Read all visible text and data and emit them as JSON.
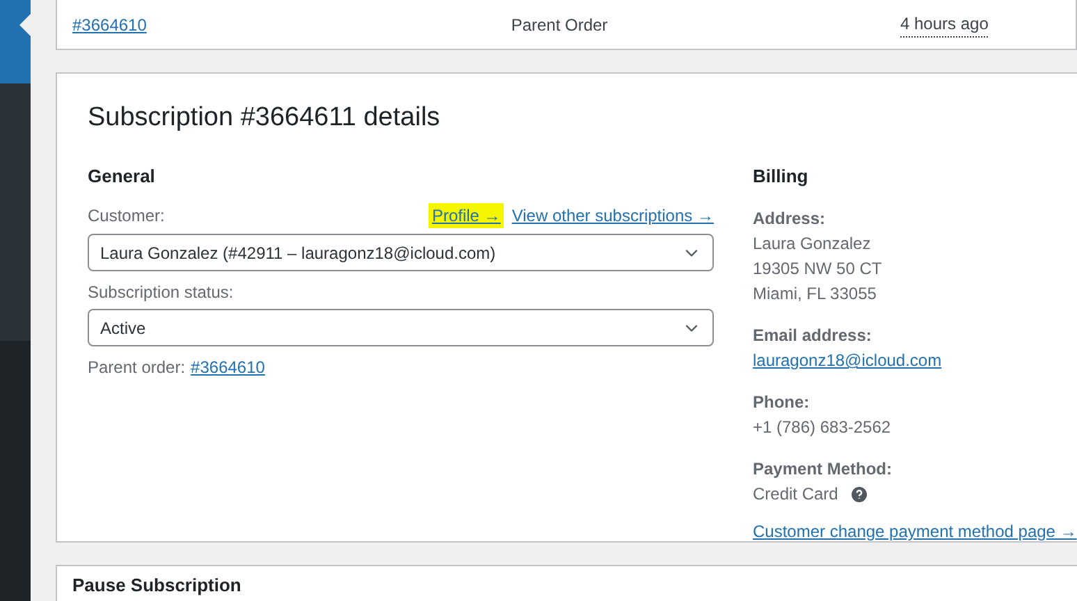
{
  "related_order": {
    "number": "#3664610",
    "relationship": "Parent Order",
    "date": "4 hours ago"
  },
  "details": {
    "title": "Subscription #3664611 details",
    "general": {
      "heading": "General",
      "customer_label": "Customer:",
      "profile_link": "Profile →",
      "profile_highlighted": true,
      "other_link": "View other subscriptions →",
      "customer_value": "Laura Gonzalez (#42911 – lauragonz18@icloud.com)",
      "status_label": "Subscription status:",
      "status_value": "Active",
      "parent_label": "Parent order:",
      "parent_link": "#3664610"
    },
    "billing": {
      "heading": "Billing",
      "address_label": "Address:",
      "address_lines": [
        "Laura Gonzalez",
        "19305 NW 50 CT",
        "Miami, FL 33055"
      ],
      "email_label": "Email address:",
      "email": "lauragonz18@icloud.com",
      "phone_label": "Phone:",
      "phone": "+1 (786) 683-2562",
      "payment_label": "Payment Method:",
      "payment": "Credit Card",
      "change_link": "Customer change payment method page →"
    }
  },
  "next_panel": {
    "title": "Pause Subscription"
  }
}
